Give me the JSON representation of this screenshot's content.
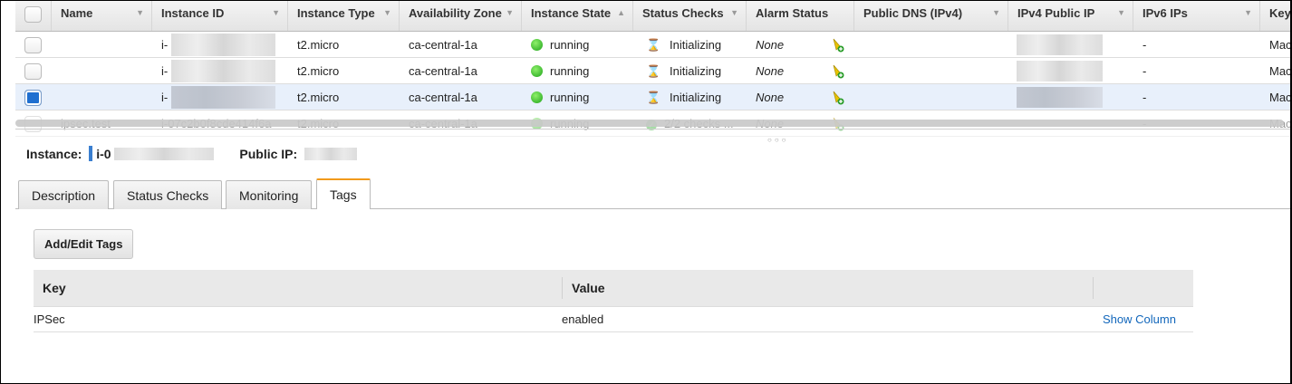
{
  "columns": [
    {
      "label": "Name",
      "sort": "▼"
    },
    {
      "label": "Instance ID",
      "sort": "▼"
    },
    {
      "label": "Instance Type",
      "sort": "▼"
    },
    {
      "label": "Availability Zone",
      "sort": "▼"
    },
    {
      "label": "Instance State",
      "sort": "▲"
    },
    {
      "label": "Status Checks",
      "sort": "▼"
    },
    {
      "label": "Alarm Status",
      "sort": ""
    },
    {
      "label": "Public DNS (IPv4)",
      "sort": "▼"
    },
    {
      "label": "IPv4 Public IP",
      "sort": "▼"
    },
    {
      "label": "IPv6 IPs",
      "sort": "▼"
    },
    {
      "label": "Key",
      "sort": ""
    }
  ],
  "rows": [
    {
      "name": "",
      "id": "i-",
      "type": "t2.micro",
      "az": "ca-central-1a",
      "state": "running",
      "status": "Initializing",
      "alarm": "None",
      "ipv6": "-",
      "key": "Mac",
      "selected": false
    },
    {
      "name": "",
      "id": "i-",
      "type": "t2.micro",
      "az": "ca-central-1a",
      "state": "running",
      "status": "Initializing",
      "alarm": "None",
      "ipv6": "-",
      "key": "Mac",
      "selected": false
    },
    {
      "name": "",
      "id": "i-",
      "type": "t2.micro",
      "az": "ca-central-1a",
      "state": "running",
      "status": "Initializing",
      "alarm": "None",
      "ipv6": "-",
      "key": "Mac",
      "selected": true
    },
    {
      "name": "ipsec.test",
      "id": "i-07c2b0f8cde414f6a",
      "type": "t2.micro",
      "az": "ca-central-1a",
      "state": "running",
      "status": "2/2 checks ...",
      "alarm": "None",
      "ipv6": "-",
      "key": "Mac",
      "selected": false
    }
  ],
  "detail": {
    "instance_label": "Instance:",
    "instance_value": "i-0",
    "public_ip_label": "Public IP:"
  },
  "tabs": [
    "Description",
    "Status Checks",
    "Monitoring",
    "Tags"
  ],
  "active_tab": "Tags",
  "tags": {
    "button": "Add/Edit Tags",
    "headers": [
      "Key",
      "Value"
    ],
    "rows": [
      {
        "key": "IPSec",
        "value": "enabled"
      }
    ],
    "show_column": "Show Column"
  },
  "colors": {
    "accent_tab": "#f19a1b",
    "link": "#1166bb",
    "selected_row": "#e8f0fb"
  }
}
